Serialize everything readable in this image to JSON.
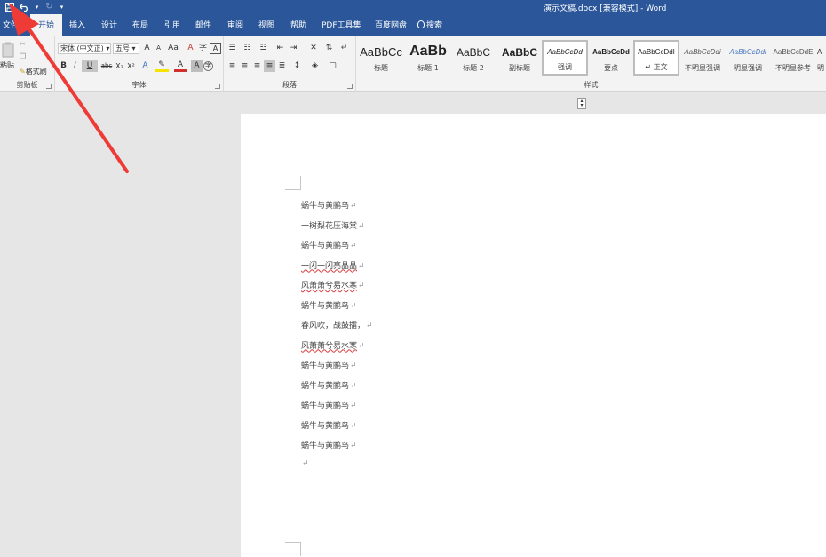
{
  "window": {
    "title": "演示文稿.docx [兼容模式] - Word",
    "qat": {
      "save_icon": "save-icon",
      "undo_icon": "undo-icon",
      "redo_icon": "redo-icon",
      "customize_icon": "qat-customize-icon"
    }
  },
  "tabs": [
    {
      "label": "文件"
    },
    {
      "label": "开始",
      "active": true
    },
    {
      "label": "插入"
    },
    {
      "label": "设计"
    },
    {
      "label": "布局"
    },
    {
      "label": "引用"
    },
    {
      "label": "邮件"
    },
    {
      "label": "审阅"
    },
    {
      "label": "视图"
    },
    {
      "label": "帮助"
    },
    {
      "label": "PDF工具集"
    },
    {
      "label": "百度网盘"
    },
    {
      "label": "搜索"
    }
  ],
  "ribbon": {
    "clipboard": {
      "label": "剪贴板",
      "paste": "粘贴",
      "format_painter": "格式刷"
    },
    "font": {
      "label": "字体",
      "font_name": "宋体 (中文正)",
      "font_size": "五号",
      "grow": "A",
      "shrink": "A",
      "case": "Aa",
      "bold": "B",
      "italic": "I",
      "underline": "U",
      "strike": "abc",
      "subscript": "X₂",
      "superscript": "X²",
      "font_color": "A",
      "char_shading": "A"
    },
    "paragraph": {
      "label": "段落"
    },
    "styles": {
      "label": "样式",
      "items": [
        {
          "preview": "AaBbCc",
          "name": "标题"
        },
        {
          "preview": "AaBb",
          "name": "标题 1"
        },
        {
          "preview": "AaBbC",
          "name": "标题 2"
        },
        {
          "preview": "AaBbC",
          "name": "副标题"
        },
        {
          "preview": "AaBbCcDd",
          "name": "强调"
        },
        {
          "preview": "AaBbCcDd",
          "name": "要点"
        },
        {
          "preview": "AaBbCcDdI",
          "name": "↵ 正文",
          "selected": true
        },
        {
          "preview": "AaBbCcDdi",
          "name": "不明显强调"
        },
        {
          "preview": "AaBbCcDdi",
          "name": "明显强调"
        },
        {
          "preview": "AaBbCcDdE",
          "name": "不明显参考"
        },
        {
          "preview": "A",
          "name": "明"
        }
      ]
    }
  },
  "document": {
    "lines": [
      {
        "text": "蜗牛与黄鹂鸟",
        "mark": "↵"
      },
      {
        "text": "一树梨花压海棠",
        "mark": "↵"
      },
      {
        "text": "蜗牛与黄鹂鸟",
        "mark": "↵"
      },
      {
        "text": "一闪一闪亮晶晶",
        "mark": "↵"
      },
      {
        "text": "风萧萧兮易水寒",
        "mark": "↵"
      },
      {
        "text": "蜗牛与黄鹂鸟",
        "mark": "↵"
      },
      {
        "text": "春风吹，战鼓擂，",
        "mark": "↵"
      },
      {
        "text": "风萧萧兮易水寒",
        "mark": "↵"
      },
      {
        "text": "蜗牛与黄鹂鸟",
        "mark": "↵"
      },
      {
        "text": "蜗牛与黄鹂鸟",
        "mark": "↵"
      },
      {
        "text": "蜗牛与黄鹂鸟",
        "mark": "↵"
      },
      {
        "text": "蜗牛与黄鹂鸟",
        "mark": "↵"
      },
      {
        "text": "蜗牛与黄鹂鸟",
        "mark": "↵"
      },
      {
        "text": "",
        "mark": "↵"
      }
    ]
  },
  "colors": {
    "accent": "#2b579a",
    "annotation_arrow": "#ef3b36",
    "ribbon_bg": "#f3f3f3",
    "doc_bg": "#e6e6e6"
  }
}
